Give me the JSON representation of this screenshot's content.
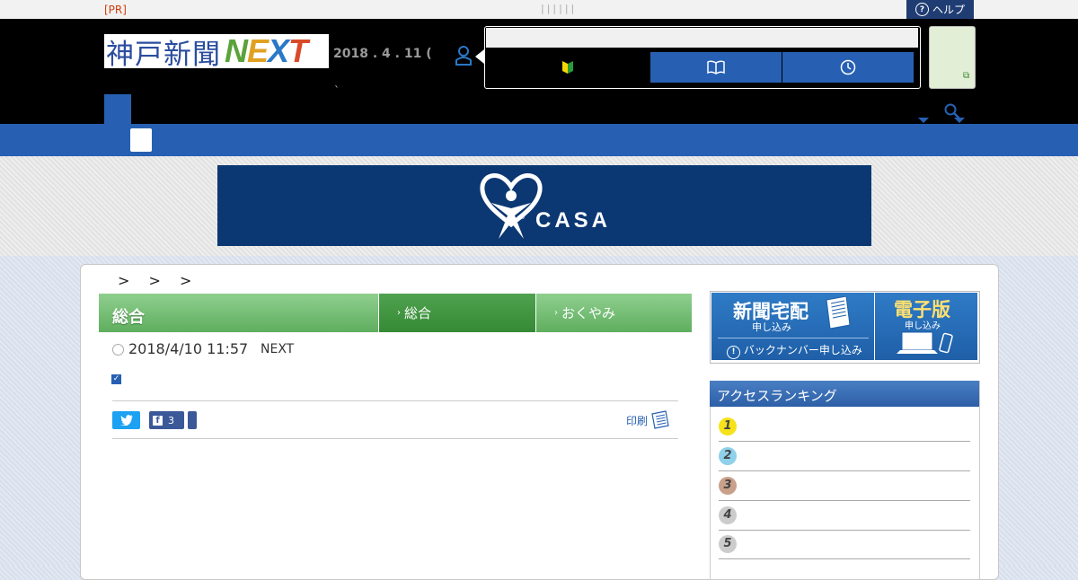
{
  "topbar": {
    "pr": "[PR]",
    "separators": "||||||",
    "help": "ヘルプ"
  },
  "header": {
    "logo_jp": "神戸新聞",
    "logo_next": {
      "n": "N",
      "e": "E",
      "x": "X",
      "t": "T"
    },
    "date": "2018 . 4 . 11 (",
    "date_tick": "`"
  },
  "ad": {
    "brand": "CASA",
    "reg": "®"
  },
  "breadcrumb": "> > >",
  "section": {
    "title": "総合",
    "tabs": [
      "総合",
      "おくやみ"
    ]
  },
  "article": {
    "timestamp": "2018/4/10 11:57",
    "source": "NEXT",
    "checkbox": "✓"
  },
  "share": {
    "facebook_count": "3",
    "print": "印刷"
  },
  "sidebar": {
    "delivery": "新聞宅配",
    "delivery_sub": "申し込み",
    "backnumber": "バックナンバー申し込み",
    "digital": "電子版",
    "digital_sub": "申し込み",
    "ranking_title": "アクセスランキング",
    "ranks": [
      "1",
      "2",
      "3",
      "4",
      "5"
    ]
  },
  "colors": {
    "brand_blue": "#2760b3",
    "section_green": "#5fae5f",
    "rank1": "#f5e21a",
    "rank2": "#8fd0ea",
    "rank3": "#c9a08a",
    "rank4": "#cccccc",
    "rank5": "#cccccc"
  },
  "icons": [
    "help-icon",
    "user-icon",
    "beginner-mark-icon",
    "book-icon",
    "clock-icon",
    "search-icon",
    "twitter-icon",
    "facebook-icon",
    "print-icon",
    "info-icon"
  ]
}
